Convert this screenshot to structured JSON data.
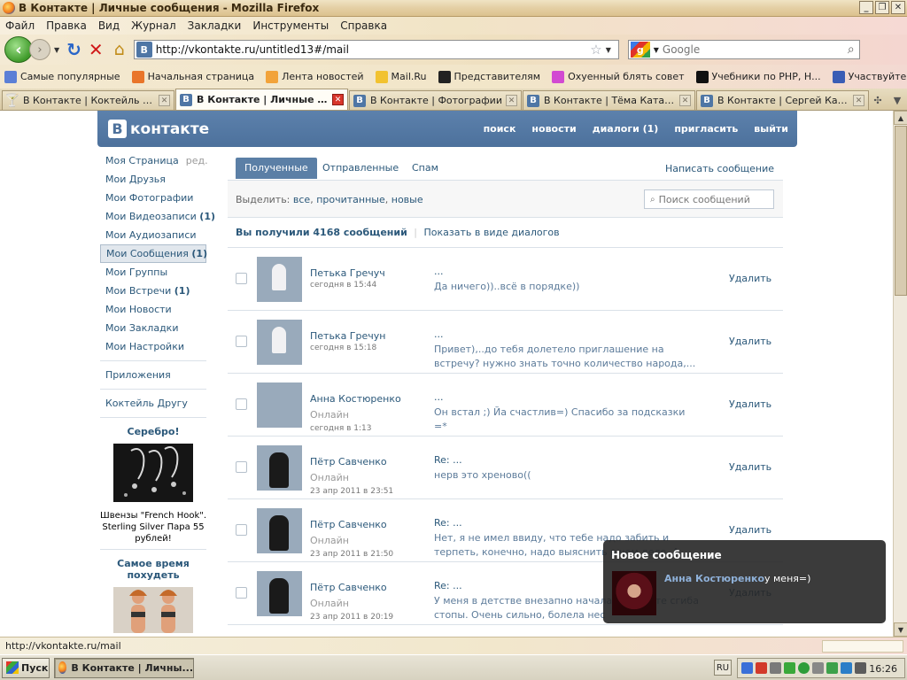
{
  "window": {
    "title": "В Контакте | Личные сообщения - Mozilla Firefox",
    "controls": [
      "_",
      "❐",
      "✕"
    ]
  },
  "menu": [
    "Файл",
    "Правка",
    "Вид",
    "Журнал",
    "Закладки",
    "Инструменты",
    "Справка"
  ],
  "navbar": {
    "url": "http://vkontakte.ru/untitled13#/mail",
    "site_icon": "В",
    "search_engine": "g",
    "search_placeholder": "Google"
  },
  "bookmarks": [
    {
      "label": "Самые популярные",
      "icon_color": "#5b7fd6"
    },
    {
      "label": "Начальная страница",
      "icon_color": "#e9752a"
    },
    {
      "label": "Лента новостей",
      "icon_color": "#f2a33a"
    },
    {
      "label": "Mail.Ru",
      "icon_color": "#f2c230"
    },
    {
      "label": "Представителям",
      "icon_color": "#222222"
    },
    {
      "label": "Охуенный блять совет",
      "icon_color": "#d24ad2"
    },
    {
      "label": "Учебники по PHP, Н...",
      "icon_color": "#111111"
    },
    {
      "label": "Участвуйте в наших...",
      "icon_color": "#3a5db5"
    }
  ],
  "tabs": [
    {
      "label": "В Контакте | Коктейль дру...",
      "icon": "🍸",
      "active": false
    },
    {
      "label": "В Контакте | Личные с...",
      "icon": "В",
      "active": true
    },
    {
      "label": "В Контакте | Фотографии",
      "icon": "В",
      "active": false
    },
    {
      "label": "В Контакте | Тёма Катасо...",
      "icon": "В",
      "active": false
    },
    {
      "label": "В Контакте | Сергей Каме...",
      "icon": "В",
      "active": false
    }
  ],
  "vk": {
    "logo_letter": "В",
    "logo_text": "контакте",
    "nav": [
      "поиск",
      "новости",
      "диалоги (1)",
      "пригласить",
      "выйти"
    ]
  },
  "sidebar": {
    "items": [
      {
        "label": "Моя Страница",
        "extra": "ред.",
        "count": "",
        "selected": false
      },
      {
        "label": "Мои Друзья",
        "extra": "",
        "count": "",
        "selected": false
      },
      {
        "label": "Мои Фотографии",
        "extra": "",
        "count": "",
        "selected": false
      },
      {
        "label": "Мои Видеозаписи",
        "extra": "",
        "count": "(1)",
        "selected": false
      },
      {
        "label": "Мои Аудиозаписи",
        "extra": "",
        "count": "",
        "selected": false
      },
      {
        "label": "Мои Сообщения",
        "extra": "",
        "count": "(1)",
        "selected": true
      },
      {
        "label": "Мои Группы",
        "extra": "",
        "count": "",
        "selected": false
      },
      {
        "label": "Мои Встречи",
        "extra": "",
        "count": "(1)",
        "selected": false
      },
      {
        "label": "Мои Новости",
        "extra": "",
        "count": "",
        "selected": false
      },
      {
        "label": "Мои Закладки",
        "extra": "",
        "count": "",
        "selected": false
      },
      {
        "label": "Мои Настройки",
        "extra": "",
        "count": "",
        "selected": false
      }
    ],
    "apps": "Приложения",
    "cocktail": "Коктейль Другу",
    "ad1": {
      "title": "Серебро!",
      "text": "Швензы \"French Hook\". Sterling Silver Пара 55 рублей!"
    },
    "ad2": {
      "title": "Самое время похудеть"
    }
  },
  "mail": {
    "tabs": [
      "Полученные",
      "Отправленные",
      "Спам"
    ],
    "write": "Написать сообщение",
    "select_label": "Выделить:",
    "select_all": "все",
    "select_read": "прочитанные",
    "select_new": "новые",
    "search_placeholder": "Поиск сообщений",
    "summary": "Вы получили 4168 сообщений",
    "as_dialogs": "Показать в виде диалогов",
    "delete_label": "Удалить",
    "messages": [
      {
        "name": "Петька Гречуч",
        "online": "",
        "date": "сегодня в 15:44",
        "subject": "...",
        "text": "Да ничего))..всё в порядке))",
        "avatar": "petka"
      },
      {
        "name": "Петька Гречун",
        "online": "",
        "date": "сегодня в 15:18",
        "subject": "...",
        "text": "Привет),..до тебя долетело приглашение на встречу? нужно знать точно количество народа,...",
        "avatar": "petka"
      },
      {
        "name": "Анна Костюренко",
        "online": "Онлайн",
        "date": "сегодня в 1:13",
        "subject": "...",
        "text": "Он встал ;) Йа счастлив=) Спасибо за подсказки =*",
        "avatar": "anna"
      },
      {
        "name": "Пётр Савченко",
        "online": "Онлайн",
        "date": "23 апр 2011 в 23:51",
        "subject": "Re: ...",
        "text": "нерв это хреново((",
        "avatar": "pyotr"
      },
      {
        "name": "Пётр Савченко",
        "online": "Онлайн",
        "date": "23 апр 2011 в 21:50",
        "subject": "Re: ...",
        "text": "Нет, я не имел ввиду, что тебе надо забить и терпеть, конечно, надо выяснить в чем дело. А",
        "avatar": "pyotr"
      },
      {
        "name": "Пётр Савченко",
        "online": "Онлайн",
        "date": "23 апр 2011 в 20:19",
        "subject": "Re: ...",
        "text": "У меня в детстве внезапно начала бол месте сгиба стопы. Очень сильно, болела нес",
        "avatar": "pyotr"
      }
    ]
  },
  "popup": {
    "title": "Новое сообщение",
    "name": "Анна Костюренко",
    "text": "у меня=)"
  },
  "statusbar": {
    "url": "http://vkontakte.ru/mail"
  },
  "taskbar": {
    "start": "Пуск",
    "window_button": "В Контакте | Личны...",
    "lang": "RU",
    "clock": "16:26"
  }
}
